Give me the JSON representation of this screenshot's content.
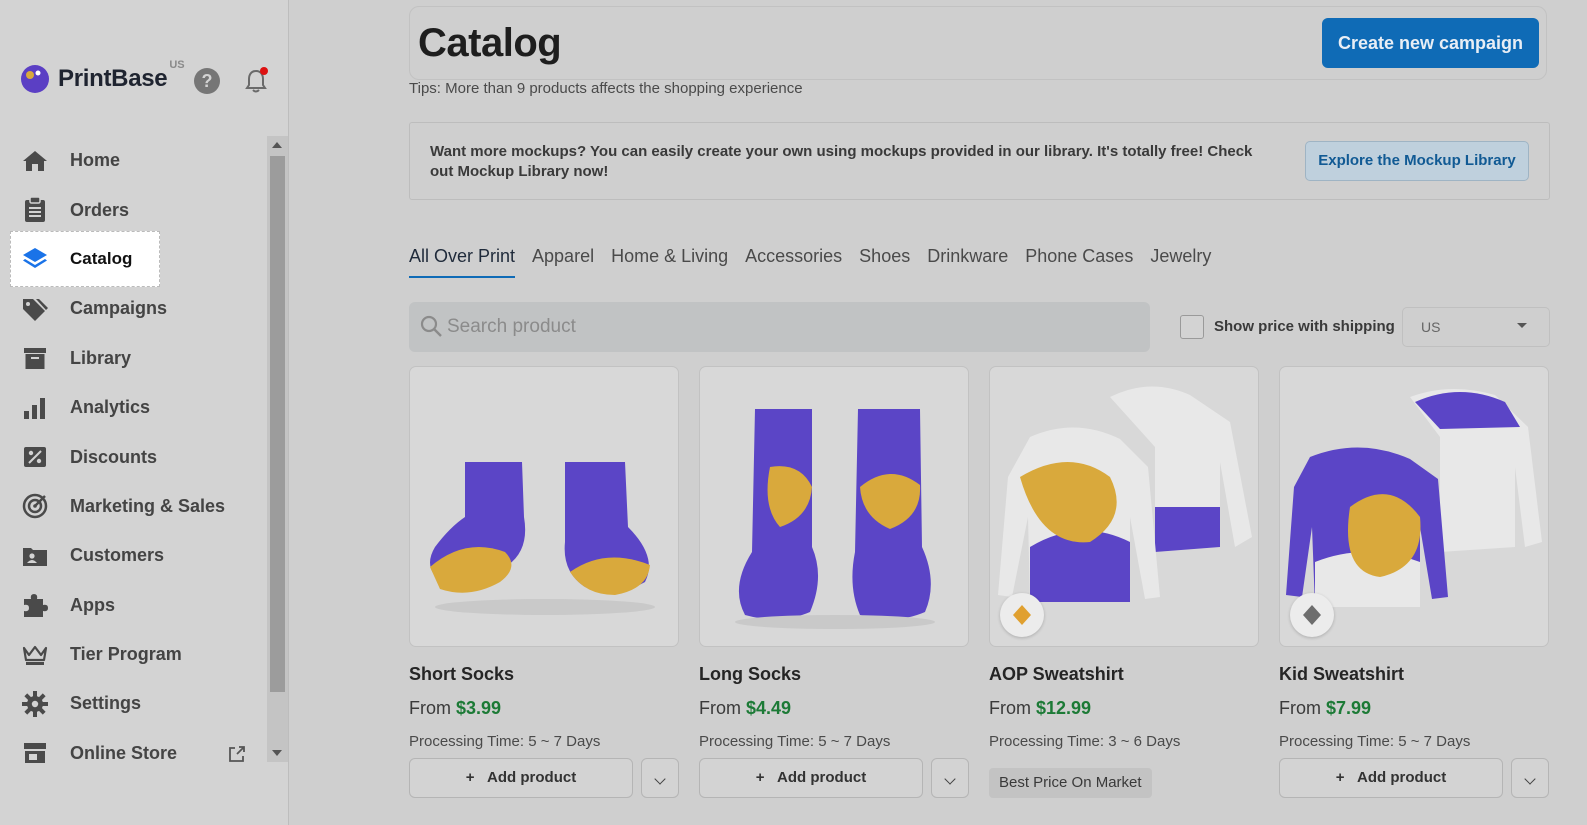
{
  "brand": {
    "name": "PrintBase",
    "region": "US"
  },
  "sidebar": {
    "items": [
      {
        "label": "Home",
        "icon": "home-icon"
      },
      {
        "label": "Orders",
        "icon": "clipboard-icon"
      },
      {
        "label": "Catalog",
        "icon": "layers-icon",
        "active": true
      },
      {
        "label": "Campaigns",
        "icon": "tags-icon"
      },
      {
        "label": "Library",
        "icon": "archive-icon"
      },
      {
        "label": "Analytics",
        "icon": "bar-chart-icon"
      },
      {
        "label": "Discounts",
        "icon": "percent-icon"
      },
      {
        "label": "Marketing & Sales",
        "icon": "target-icon"
      },
      {
        "label": "Customers",
        "icon": "customers-icon"
      },
      {
        "label": "Apps",
        "icon": "puzzle-icon"
      },
      {
        "label": "Tier Program",
        "icon": "crown-icon"
      },
      {
        "label": "Settings",
        "icon": "gear-icon"
      },
      {
        "label": "Online Store",
        "icon": "store-icon"
      }
    ]
  },
  "header": {
    "title": "Catalog",
    "create_button": "Create new campaign",
    "tips": "Tips: More than 9 products affects the shopping experience"
  },
  "mockup_banner": {
    "text": "Want more mockups? You can easily create your own using mockups provided in our library. It's totally free! Check out Mockup Library now!",
    "button": "Explore the Mockup Library"
  },
  "tabs": [
    "All Over Print",
    "Apparel",
    "Home & Living",
    "Accessories",
    "Shoes",
    "Drinkware",
    "Phone Cases",
    "Jewelry"
  ],
  "search": {
    "placeholder": "Search product"
  },
  "shipping": {
    "label": "Show price with shipping",
    "country": "US"
  },
  "products": [
    {
      "name": "Short Socks",
      "price_prefix": "From ",
      "price": "$3.99",
      "processing": "Processing Time: 5 ~ 7 Days",
      "action": "Add product"
    },
    {
      "name": "Long Socks",
      "price_prefix": "From ",
      "price": "$4.49",
      "processing": "Processing Time: 5 ~ 7 Days",
      "action": "Add product"
    },
    {
      "name": "AOP Sweatshirt",
      "price_prefix": "From ",
      "price": "$12.99",
      "processing": "Processing Time: 3 ~ 6 Days",
      "badge": "Best Price On Market"
    },
    {
      "name": "Kid Sweatshirt",
      "price_prefix": "From ",
      "price": "$7.99",
      "processing": "Processing Time: 5 ~ 7 Days",
      "action": "Add product"
    }
  ],
  "colors": {
    "accent": "#0f6bb6",
    "price": "#1c7a36",
    "brand_purple": "#5b3fc4",
    "brand_gold": "#d9a93c"
  }
}
